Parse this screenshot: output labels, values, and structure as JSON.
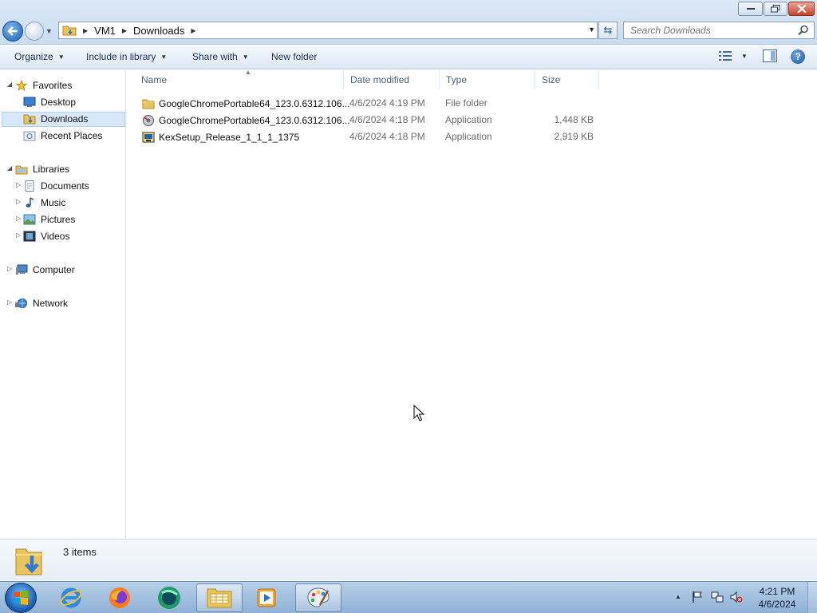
{
  "window": {
    "controls": {
      "minimize": "minimize",
      "maximize": "maximize",
      "close": "close"
    }
  },
  "address": {
    "breadcrumbs": [
      "VM1",
      "Downloads"
    ]
  },
  "search": {
    "placeholder": "Search Downloads"
  },
  "commands": {
    "organize": "Organize",
    "include_in_library": "Include in library",
    "share_with": "Share with",
    "new_folder": "New folder"
  },
  "navigation": {
    "favorites": {
      "label": "Favorites",
      "items": [
        "Desktop",
        "Downloads",
        "Recent Places"
      ]
    },
    "libraries": {
      "label": "Libraries",
      "items": [
        "Documents",
        "Music",
        "Pictures",
        "Videos"
      ]
    },
    "computer": "Computer",
    "network": "Network",
    "selected": "Downloads"
  },
  "file_list": {
    "columns": [
      "Name",
      "Date modified",
      "Type",
      "Size"
    ],
    "rows": [
      {
        "name": "GoogleChromePortable64_123.0.6312.106...",
        "date": "4/6/2024 4:19 PM",
        "type": "File folder",
        "size": "",
        "icon": "folder-icon"
      },
      {
        "name": "GoogleChromePortable64_123.0.6312.106...",
        "date": "4/6/2024 4:18 PM",
        "type": "Application",
        "size": "1,448 KB",
        "icon": "installer-icon"
      },
      {
        "name": "KexSetup_Release_1_1_1_1375",
        "date": "4/6/2024 4:18 PM",
        "type": "Application",
        "size": "2,919 KB",
        "icon": "setup-icon"
      }
    ]
  },
  "details": {
    "item_count": "3 items"
  },
  "taskbar": {
    "apps": [
      "internet-explorer",
      "firefox",
      "app-green-circle",
      "windows-explorer",
      "media-player",
      "paint"
    ],
    "active_apps": [
      "windows-explorer",
      "paint"
    ],
    "clock_time": "4:21 PM",
    "clock_date": "4/6/2024"
  },
  "colors": {
    "accent": "#1b5fb3",
    "selection": "#d9e8f9",
    "header_text": "#4c607a"
  }
}
